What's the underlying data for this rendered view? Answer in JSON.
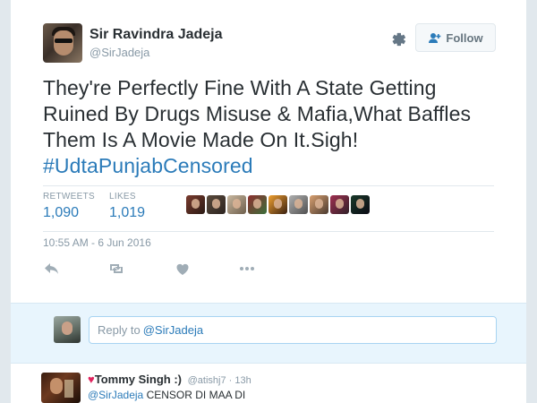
{
  "tweet": {
    "user_name": "Sir Ravindra Jadeja",
    "user_handle": "@SirJadeja",
    "follow_label": "Follow",
    "text": "They're Perfectly Fine With A State Getting Ruined By Drugs Misuse & Mafia,What Baffles Them Is A Movie Made On It.Sigh!",
    "hashtag": "#UdtaPunjabCensored",
    "timestamp": "10:55 AM - 6 Jun 2016"
  },
  "stats": {
    "retweets_label": "RETWEETS",
    "retweets_value": "1,090",
    "likes_label": "LIKES",
    "likes_value": "1,019"
  },
  "likers": [
    {
      "color_a": "#7a3b2e",
      "color_b": "#2a1a14"
    },
    {
      "color_a": "#5a4a3c",
      "color_b": "#2c2420"
    },
    {
      "color_a": "#c9b8a0",
      "color_b": "#6e5f4c"
    },
    {
      "color_a": "#8e2f2f",
      "color_b": "#3a6e3a"
    },
    {
      "color_a": "#f0a030",
      "color_b": "#3a2010"
    },
    {
      "color_a": "#b0b0b0",
      "color_b": "#505050"
    },
    {
      "color_a": "#d8a070",
      "color_b": "#4a3a30"
    },
    {
      "color_a": "#a03050",
      "color_b": "#302028"
    },
    {
      "color_a": "#1a3a2a",
      "color_b": "#0a0a14"
    }
  ],
  "actions": {
    "reply_icon": "reply-icon",
    "retweet_icon": "retweet-icon",
    "like_icon": "heart-icon",
    "more_icon": "more-icon"
  },
  "reply_box": {
    "prefix": "Reply to",
    "mention": "@SirJadeja"
  },
  "comment": {
    "heart": "♥",
    "name": "Tommy Singh :)",
    "handle": "@atishj7 · 13h",
    "mention": "@SirJadeja",
    "text": "CENSOR DI MAA DI"
  },
  "colors": {
    "link": "#2b7bb9",
    "muted": "#8899a6",
    "text": "#292f33",
    "reply_bg": "#e8f5fd",
    "page_bg": "#e1e8ed"
  }
}
